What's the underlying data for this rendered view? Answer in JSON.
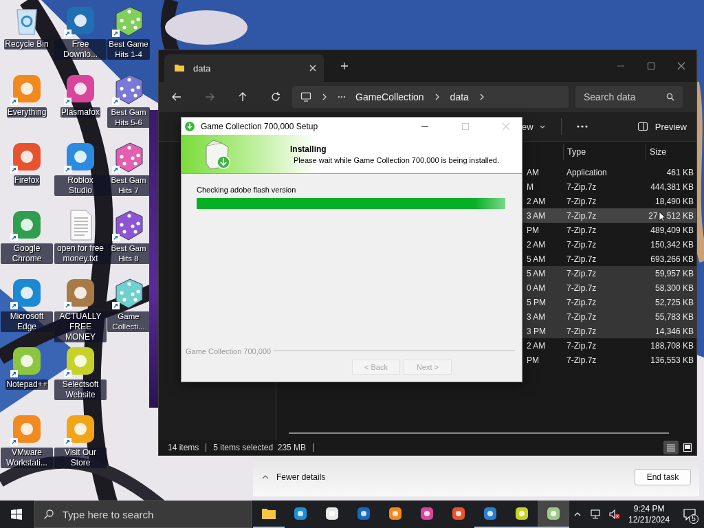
{
  "desktop_icons": [
    {
      "label": "Recycle Bin",
      "kind": "bin",
      "shortcut": false
    },
    {
      "label": "Everything",
      "kind": "app",
      "color": "#f08a1c",
      "shortcut": true
    },
    {
      "label": "Firefox",
      "kind": "app",
      "color": "#e8532f",
      "shortcut": true
    },
    {
      "label": "Google Chrome",
      "kind": "app",
      "color": "#2f9e4f",
      "shortcut": true
    },
    {
      "label": "Microsoft Edge",
      "kind": "app",
      "color": "#1b8ad3",
      "shortcut": true
    },
    {
      "label": "Notepad++",
      "kind": "app",
      "color": "#8cc63f",
      "shortcut": true
    },
    {
      "label": "VMware Workstati...",
      "kind": "app",
      "color": "#f18b21",
      "shortcut": true
    },
    {
      "label": "Free Downlo...",
      "kind": "app",
      "color": "#1f6fb5",
      "shortcut": true
    },
    {
      "label": "Plasmafox",
      "kind": "app",
      "color": "#d8459a",
      "shortcut": true
    },
    {
      "label": "Roblox Studio",
      "kind": "app",
      "color": "#2b8be0",
      "shortcut": true
    },
    {
      "label": "open for free money.txt",
      "kind": "file",
      "shortcut": false
    },
    {
      "label": "ACTUALLY FREE MONEY",
      "kind": "app",
      "color": "#a87a45",
      "shortcut": true
    },
    {
      "label": "Selectsoft Website",
      "kind": "app",
      "color": "#c6d22a",
      "shortcut": true
    },
    {
      "label": "Visit Our Store",
      "kind": "app",
      "color": "#f2a516",
      "shortcut": true
    },
    {
      "label": "Best Game Hits 1-4",
      "kind": "dice",
      "color": "#7fcf5a",
      "shortcut": true
    },
    {
      "label": "Best Gam Hits 5-6",
      "kind": "dice",
      "color": "#7a78d8",
      "shortcut": true
    },
    {
      "label": "Best Gam Hits 7",
      "kind": "dice",
      "color": "#e25fb2",
      "shortcut": true
    },
    {
      "label": "Best Gam Hits 8",
      "kind": "dice",
      "color": "#8d55d6",
      "shortcut": true
    },
    {
      "label": "Game Collecti...",
      "kind": "dice",
      "color": "#6fd0d0",
      "shortcut": true
    }
  ],
  "explorer": {
    "tab": {
      "label": "data"
    },
    "address": {
      "segments": [
        "GameCollection",
        "data"
      ]
    },
    "search": {
      "placeholder": "Search data"
    },
    "command_bar": {
      "view_label": "ew",
      "preview_label": "Preview"
    },
    "columns": [
      "Type",
      "Size"
    ],
    "rows": [
      {
        "date": "AM",
        "type": "Application",
        "size": "461 KB",
        "selected": false,
        "hovered": false
      },
      {
        "date": "M",
        "type": "7-Zip.7z",
        "size": "444,381 KB",
        "selected": false,
        "hovered": false
      },
      {
        "date": "2 AM",
        "type": "7-Zip.7z",
        "size": "18,490 KB",
        "selected": false,
        "hovered": false
      },
      {
        "date": "3 AM",
        "type": "7-Zip.7z",
        "size": "27",
        "size_tail": "512 KB",
        "selected": false,
        "hovered": true
      },
      {
        "date": "PM",
        "type": "7-Zip.7z",
        "size": "489,409 KB",
        "selected": false,
        "hovered": false
      },
      {
        "date": "2 AM",
        "type": "7-Zip.7z",
        "size": "150,342 KB",
        "selected": false,
        "hovered": false
      },
      {
        "date": "5 AM",
        "type": "7-Zip.7z",
        "size": "693,266 KB",
        "selected": false,
        "hovered": false
      },
      {
        "date": "5 AM",
        "type": "7-Zip.7z",
        "size": "59,957 KB",
        "selected": true,
        "hovered": false
      },
      {
        "date": "0 AM",
        "type": "7-Zip.7z",
        "size": "58,300 KB",
        "selected": true,
        "hovered": false
      },
      {
        "date": "5 PM",
        "type": "7-Zip.7z",
        "size": "52,725 KB",
        "selected": true,
        "hovered": false
      },
      {
        "date": "3 AM",
        "type": "7-Zip.7z",
        "size": "55,783 KB",
        "selected": true,
        "hovered": false
      },
      {
        "date": "3 PM",
        "type": "7-Zip.7z",
        "size": "14,346 KB",
        "selected": true,
        "hovered": false
      },
      {
        "date": "2 AM",
        "type": "7-Zip.7z",
        "size": "188,708 KB",
        "selected": false,
        "hovered": false
      },
      {
        "date": "PM",
        "type": "7-Zip.7z",
        "size": "136,553 KB",
        "selected": false,
        "hovered": false
      }
    ],
    "status": {
      "item_count": "14 items",
      "selection": "5 items selected  235 MB"
    },
    "view_buttons": [
      {
        "kind": "details",
        "selected": true
      },
      {
        "kind": "tiles",
        "selected": false
      }
    ]
  },
  "setup": {
    "title": "Game Collection 700,000 Setup",
    "heading": "Installing",
    "subheading": "Please wait while Game Collection 700,000 is being installed.",
    "status": "Checking adobe flash version",
    "progress": {
      "level": 1
    },
    "brand": "Game Collection 700,000",
    "buttons": [
      {
        "label": "< Back",
        "disabled": true
      },
      {
        "label": "Next >",
        "disabled": true
      }
    ]
  },
  "task_manager": {
    "toggle_label": "Fewer details",
    "end_button": "End task"
  },
  "taskbar": {
    "search_placeholder": "Type here to search",
    "apps": [
      {
        "kind": "folder",
        "color": "#f4c542",
        "running": true,
        "active": false
      },
      {
        "kind": "app",
        "color": "#1e8fd6",
        "running": false,
        "active": false
      },
      {
        "kind": "app",
        "color": "#e9e9e9",
        "running": false,
        "active": false
      },
      {
        "kind": "app",
        "color": "#1668c1",
        "running": false,
        "active": false
      },
      {
        "kind": "app",
        "color": "#f08a1c",
        "running": false,
        "active": false
      },
      {
        "kind": "app",
        "color": "#d8459a",
        "running": false,
        "active": false
      },
      {
        "kind": "app",
        "color": "#e8532f",
        "running": false,
        "active": false
      },
      {
        "kind": "app",
        "color": "#2a7fd0",
        "running": true,
        "active": false
      },
      {
        "kind": "app",
        "color": "#c6d22a",
        "running": true,
        "active": false
      },
      {
        "kind": "app",
        "color": "#9fc98a",
        "running": true,
        "active": true
      }
    ],
    "volume_muted": true,
    "time": "9:24 PM",
    "date": "12/21/2024",
    "notification_count": "5"
  }
}
